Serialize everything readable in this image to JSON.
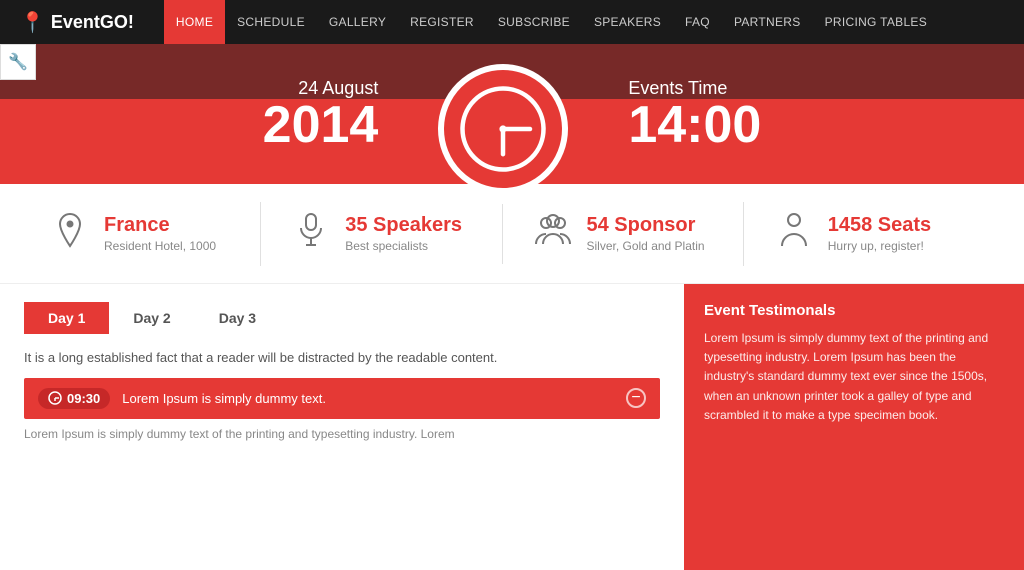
{
  "nav": {
    "logo": "EventGO!",
    "items": [
      {
        "label": "HOME",
        "active": true
      },
      {
        "label": "SCHEDULE",
        "active": false
      },
      {
        "label": "GALLERY",
        "active": false
      },
      {
        "label": "REGISTER",
        "active": false
      },
      {
        "label": "SUBSCRIBE",
        "active": false
      },
      {
        "label": "SPEAKERS",
        "active": false
      },
      {
        "label": "FAQ",
        "active": false
      },
      {
        "label": "PARTNERS",
        "active": false
      },
      {
        "label": "PRICING TABLES",
        "active": false
      }
    ]
  },
  "hero": {
    "date_label": "24 August",
    "date_year": "2014",
    "time_label": "Events Time",
    "time_value": "14:00"
  },
  "stats": [
    {
      "title": "France",
      "sub": "Resident Hotel, 1000"
    },
    {
      "title": "35 Speakers",
      "sub": "Best specialists"
    },
    {
      "title": "54 Sponsor",
      "sub": "Silver, Gold and Platin"
    },
    {
      "title": "1458 Seats",
      "sub": "Hurry up, register!"
    }
  ],
  "schedule": {
    "tabs": [
      "Day 1",
      "Day 2",
      "Day 3"
    ],
    "active_tab": 0,
    "description": "It is a long established fact that a reader will be distracted by the readable content.",
    "items": [
      {
        "time": "09:30",
        "title": "Lorem Ipsum is simply dummy text."
      }
    ],
    "more_text": "Lorem Ipsum is simply dummy text of the printing and typesetting industry. Lorem"
  },
  "testimonials": {
    "title": "Event Testimonals",
    "text": "Lorem Ipsum is simply dummy text of the printing and typesetting industry. Lorem Ipsum has been the industry's standard dummy text ever since the 1500s, when an unknown printer took a galley of type and scrambled it to make a type specimen book."
  },
  "colors": {
    "red": "#e53935",
    "dark": "#1a1a1a"
  }
}
